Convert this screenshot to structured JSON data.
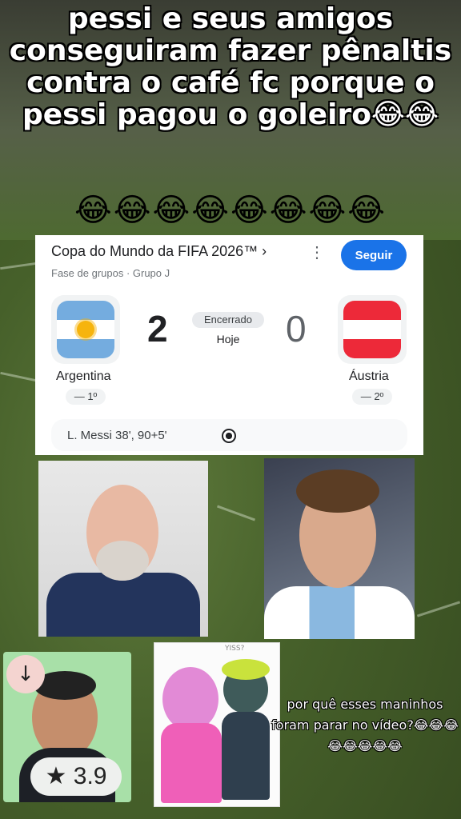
{
  "overlay": {
    "top_text": "pessi e seus amigos conseguiram fazer pênaltis contra o café fc porque o pessi pagou o goleiro😂😂",
    "emoji_row": "😂😂😂😂😂😂😂😂",
    "bottom_caption": "por quê esses maninhos foram parar no vídeo?😂😂😂😂😂😂😂😂"
  },
  "card": {
    "competition": "Copa do Mundo da FIFA 2026™ ›",
    "stage": "Fase de grupos · Grupo J",
    "follow_label": "Seguir",
    "more_icon": "more-vert-icon",
    "status": "Encerrado",
    "date": "Hoje",
    "home": {
      "name": "Argentina",
      "score": "2",
      "rank": "— 1º",
      "flag": "argentina-flag"
    },
    "away": {
      "name": "Áustria",
      "score": "0",
      "rank": "— 2º",
      "flag": "austria-flag"
    },
    "scorers": "L. Messi 38', 90+5'",
    "scorer_icon": "soccer-ball-icon"
  },
  "player_card": {
    "rating": "★ 3.9",
    "download_icon": "arrow-down-icon"
  },
  "cartoon": {
    "caption": "YISS?"
  },
  "colors": {
    "accent": "#1a73e8",
    "caption_text": "#ffffff"
  }
}
